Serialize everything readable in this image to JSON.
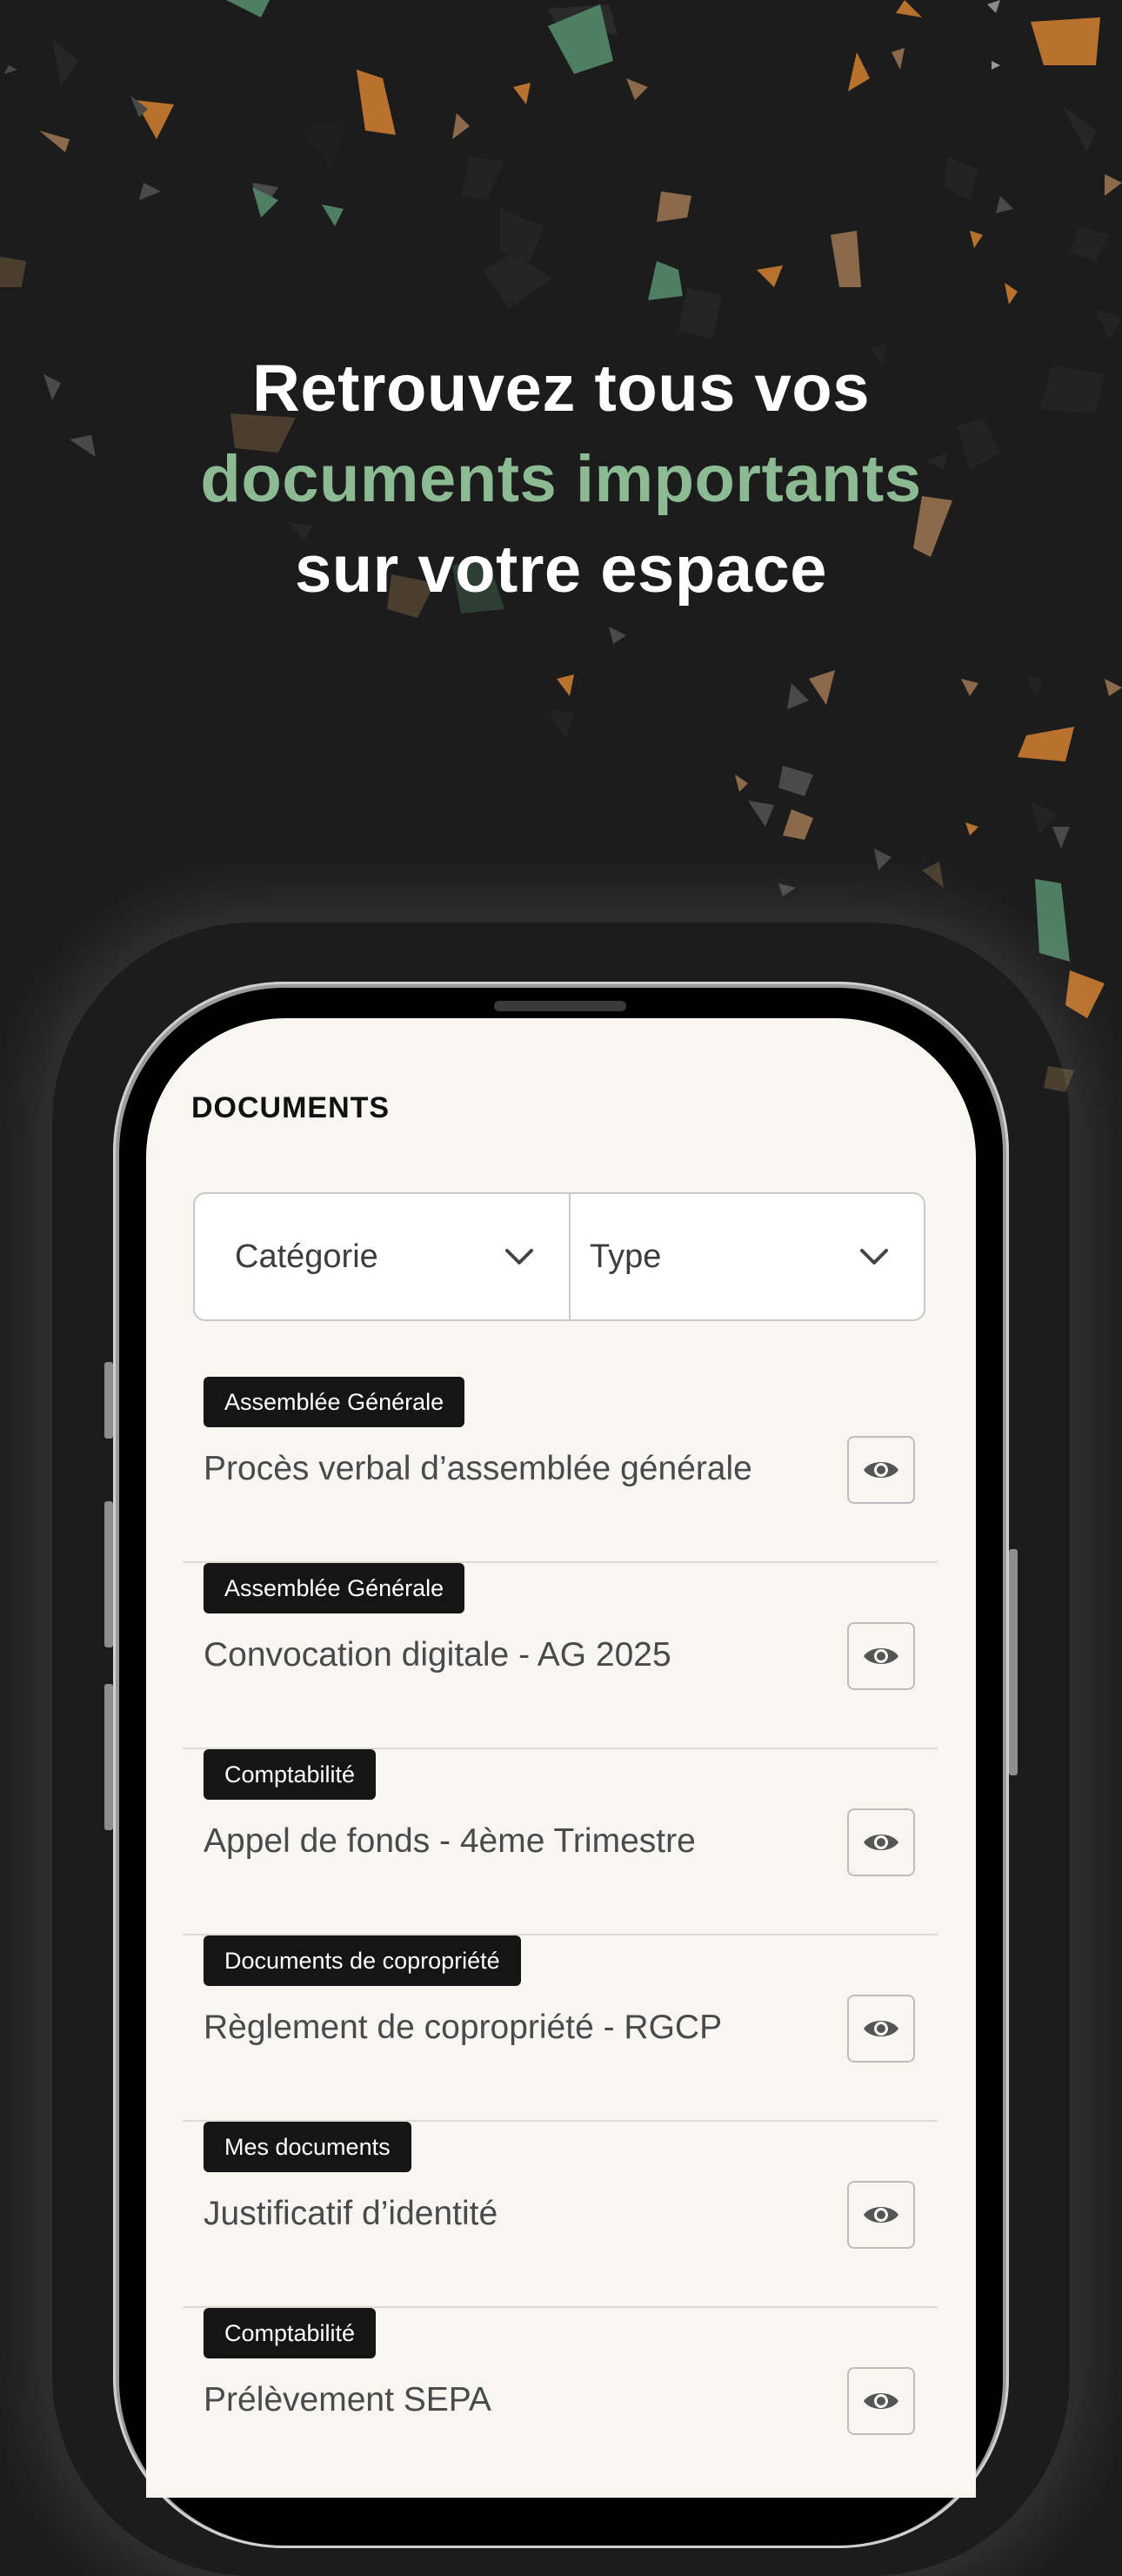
{
  "headline": {
    "line1": "Retrouvez tous vos",
    "line2": "documents importants",
    "line3": "sur votre espace"
  },
  "colors": {
    "background": "#1c1c1c",
    "accent": "#8bba93",
    "screen": "#f8f6f1",
    "badge": "#151515"
  },
  "app": {
    "title": "DOCUMENTS",
    "filters": [
      {
        "label": "Catégorie",
        "icon": "chevron-down-icon"
      },
      {
        "label": "Type",
        "icon": "chevron-down-icon"
      }
    ],
    "documents": [
      {
        "category": "Assemblée Générale",
        "title": "Procès verbal d’assemblée générale",
        "icon": "eye-icon"
      },
      {
        "category": "Assemblée Générale",
        "title": "Convocation digitale - AG 2025",
        "icon": "eye-icon"
      },
      {
        "category": "Comptabilité",
        "title": "Appel de fonds - 4ème Trimestre",
        "icon": "eye-icon"
      },
      {
        "category": "Documents de copropriété",
        "title": "Règlement de copropriété - RGCP",
        "icon": "eye-icon"
      },
      {
        "category": "Mes documents",
        "title": "Justificatif d’identité",
        "icon": "eye-icon"
      },
      {
        "category": "Comptabilité",
        "title": "Prélèvement SEPA",
        "icon": "eye-icon"
      }
    ]
  }
}
